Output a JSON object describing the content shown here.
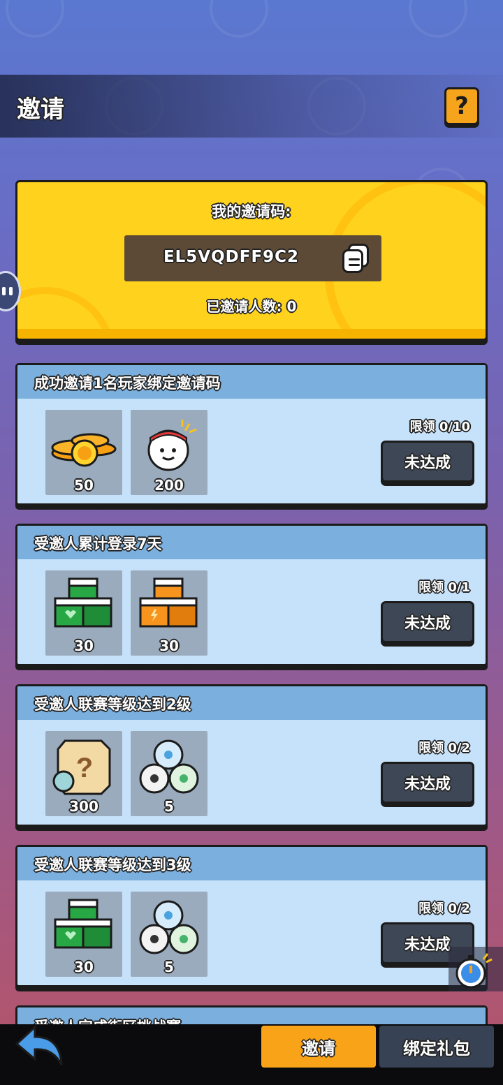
{
  "header": {
    "title": "邀请",
    "help_label": "?"
  },
  "invite_code_card": {
    "label": "我的邀请码:",
    "code": "EL5VQDFF9C2",
    "invited_count_text": "已邀请人数: 0"
  },
  "tasks": [
    {
      "title": "成功邀请1名玩家绑定邀请码",
      "limit": "限领 0/10",
      "status": "未达成",
      "rewards": [
        {
          "icon": "gold-coins-icon",
          "count": "50"
        },
        {
          "icon": "player-avatar-icon",
          "count": "200"
        }
      ]
    },
    {
      "title": "受邀人累计登录7天",
      "limit": "限领 0/1",
      "status": "未达成",
      "rewards": [
        {
          "icon": "green-heart-boxes-icon",
          "count": "30"
        },
        {
          "icon": "orange-energy-boxes-icon",
          "count": "30"
        }
      ]
    },
    {
      "title": "受邀人联赛等级达到2级",
      "limit": "限领 0/2",
      "status": "未达成",
      "rewards": [
        {
          "icon": "mystery-scroll-icon",
          "count": "300"
        },
        {
          "icon": "soccer-balls-icon",
          "count": "5"
        }
      ]
    },
    {
      "title": "受邀人联赛等级达到3级",
      "limit": "限领 0/2",
      "status": "未达成",
      "rewards": [
        {
          "icon": "green-heart-boxes-icon",
          "count": "30"
        },
        {
          "icon": "soccer-balls-icon",
          "count": "5"
        }
      ]
    }
  ],
  "partial_task": {
    "title": "受邀人完成街区挑战赛"
  },
  "bottom_bar": {
    "invite_label": "邀请",
    "bind_gift_label": "绑定礼包"
  },
  "colors": {
    "accent_orange": "#f9a319",
    "card_yellow": "#ffd21e",
    "task_body": "#c6e2fb",
    "task_header": "#7bb0de",
    "button_dark": "#3e4756"
  }
}
